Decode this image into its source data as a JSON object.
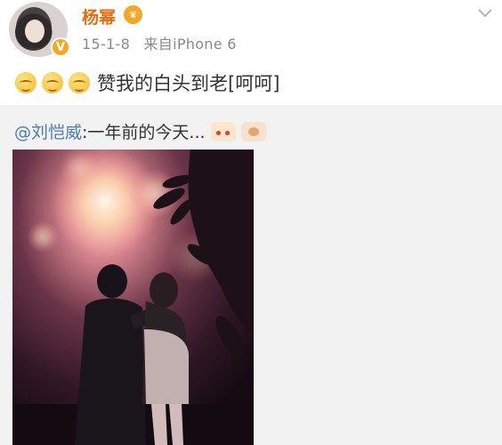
{
  "post": {
    "user": {
      "name": "杨幂",
      "vip_badge": "♛",
      "verified_badge": "V"
    },
    "meta": {
      "date": "15-1-8",
      "source": "来自iPhone 6"
    },
    "content": {
      "emoji_count": 3,
      "text": "赞我的白头到老[呵呵]"
    },
    "repost": {
      "mention": "@刘恺威",
      "text": ":一年前的今天...",
      "image": {
        "alt": "fireworks couple photo"
      }
    }
  },
  "colors": {
    "username": "#e86b0e",
    "mention": "#4a7cb0",
    "repost_bg": "#f2f2f2",
    "meta": "#8a8a8a"
  },
  "icons": [
    "avatar",
    "verified-badge-icon",
    "vip-icon",
    "chevron-down-icon",
    "smile-emoji-icon",
    "couple-sticker-icon",
    "heart-sticker-icon"
  ]
}
